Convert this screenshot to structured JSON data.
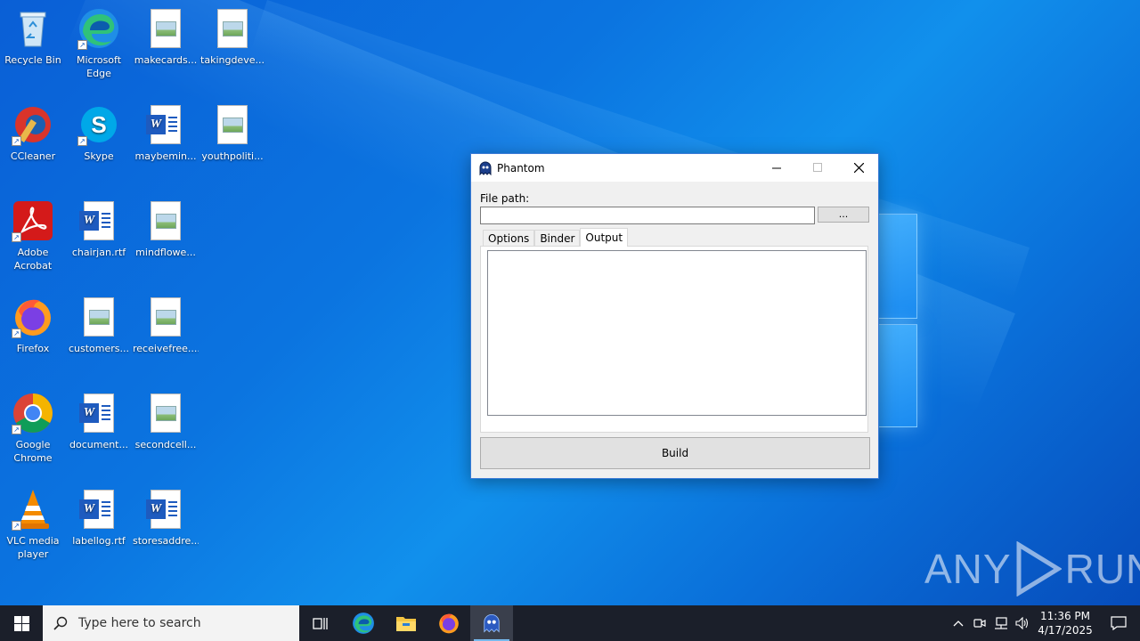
{
  "desktop": {
    "icons": [
      {
        "label": "Recycle Bin",
        "icon": "recycle-bin-icon"
      },
      {
        "label": "Microsoft Edge",
        "icon": "edge-icon"
      },
      {
        "label": "makecards...",
        "icon": "image-file-icon"
      },
      {
        "label": "takingdeve...",
        "icon": "image-file-icon"
      },
      {
        "label": "CCleaner",
        "icon": "ccleaner-icon"
      },
      {
        "label": "Skype",
        "icon": "skype-icon"
      },
      {
        "label": "maybemin...",
        "icon": "word-doc-icon"
      },
      {
        "label": "youthpoliti...",
        "icon": "image-file-icon"
      },
      {
        "label": "Adobe Acrobat",
        "icon": "acrobat-icon"
      },
      {
        "label": "chairjan.rtf",
        "icon": "word-doc-icon"
      },
      {
        "label": "mindflowe...",
        "icon": "image-file-icon"
      },
      {
        "label": "Firefox",
        "icon": "firefox-icon"
      },
      {
        "label": "customers...",
        "icon": "image-file-icon"
      },
      {
        "label": "receivefree....",
        "icon": "image-file-icon"
      },
      {
        "label": "Google Chrome",
        "icon": "chrome-icon"
      },
      {
        "label": "document...",
        "icon": "word-doc-icon"
      },
      {
        "label": "secondcell...",
        "icon": "image-file-icon"
      },
      {
        "label": "VLC media player",
        "icon": "vlc-icon"
      },
      {
        "label": "labellog.rtf",
        "icon": "word-doc-icon"
      },
      {
        "label": "storesaddre...",
        "icon": "word-doc-icon"
      }
    ]
  },
  "window": {
    "title": "Phantom",
    "file_path_label": "File path:",
    "file_path_value": "",
    "browse_label": "...",
    "tabs": [
      {
        "label": "Options",
        "active": false
      },
      {
        "label": "Binder",
        "active": false
      },
      {
        "label": "Output",
        "active": true
      }
    ],
    "output_text": "",
    "build_label": "Build"
  },
  "watermark": {
    "left": "ANY",
    "right": "RUN"
  },
  "taskbar": {
    "search_placeholder": "Type here to search",
    "apps": [
      "task-view-icon",
      "edge-icon",
      "file-explorer-icon",
      "firefox-icon",
      "phantom-icon"
    ],
    "clock_time": "11:36 PM",
    "clock_date": "4/17/2025"
  },
  "colors": {
    "accent": "#3b7bd6",
    "taskbar": "#1b1f2a",
    "desktop": "#0b74e0"
  }
}
